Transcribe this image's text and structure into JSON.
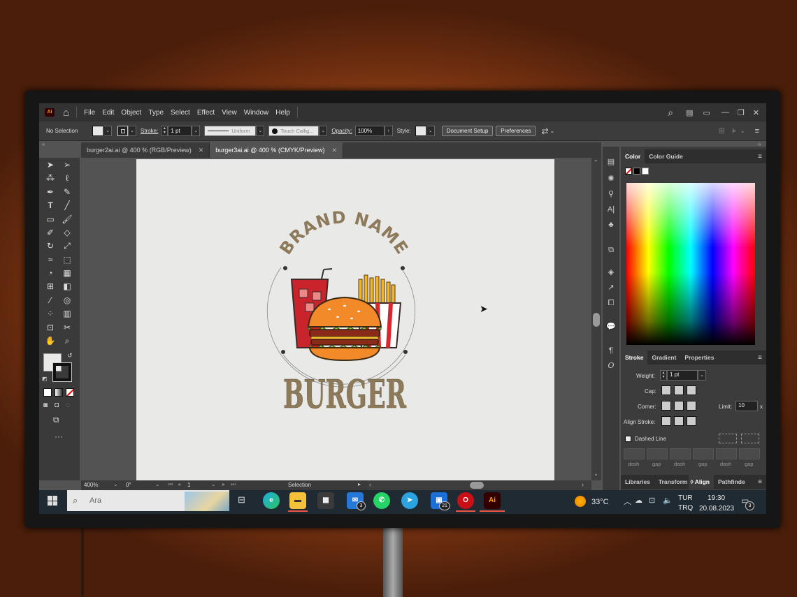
{
  "app": {
    "badge": "Ai"
  },
  "menu": [
    "File",
    "Edit",
    "Object",
    "Type",
    "Select",
    "Effect",
    "View",
    "Window",
    "Help"
  ],
  "control_bar": {
    "selection_label": "No Selection",
    "stroke_label": "Stroke:",
    "stroke_value": "1 pt",
    "profile_label": "Uniform",
    "brush_label": "Touch Callig...",
    "opacity_label": "Opacity:",
    "opacity_value": "100%",
    "style_label": "Style:",
    "document_setup": "Document Setup",
    "preferences": "Preferences"
  },
  "tabs": [
    {
      "label": "burger2ai.ai @ 400 % (RGB/Preview)"
    },
    {
      "label": "burger3ai.ai @ 400 % (CMYK/Preview)"
    }
  ],
  "artwork": {
    "arc_text": "BRAND NAME",
    "main_text": "BURGER",
    "brand_color": "#8d7a5a"
  },
  "status": {
    "zoom": "400%",
    "rotation": "0°",
    "page": "1",
    "tool": "Selection"
  },
  "panels": {
    "color_tabs": [
      "Color",
      "Color Guide"
    ],
    "stroke_tabs": [
      "Stroke",
      "Gradient",
      "Properties"
    ],
    "weight_label": "Weight:",
    "weight_value": "1 pt",
    "cap_label": "Cap:",
    "corner_label": "Corner:",
    "limit_label": "Limit:",
    "limit_value": "10",
    "limit_unit": "x",
    "align_stroke_label": "Align Stroke:",
    "dashed_line_label": "Dashed Line",
    "dash_labels": [
      "dash",
      "gap",
      "dash",
      "gap",
      "dash",
      "gap"
    ],
    "bottom_tabs": [
      "Libraries",
      "Transform",
      "Align",
      "Pathfinde"
    ]
  },
  "taskbar": {
    "search_placeholder": "Ara",
    "weather": "33°C",
    "lang_top": "TUR",
    "lang_bottom": "TRQ",
    "time": "19:30",
    "date": "20.08.2023",
    "mail_badge": "3",
    "files_badge": "21",
    "notif_badge": "3",
    "ai_label": "Ai"
  }
}
